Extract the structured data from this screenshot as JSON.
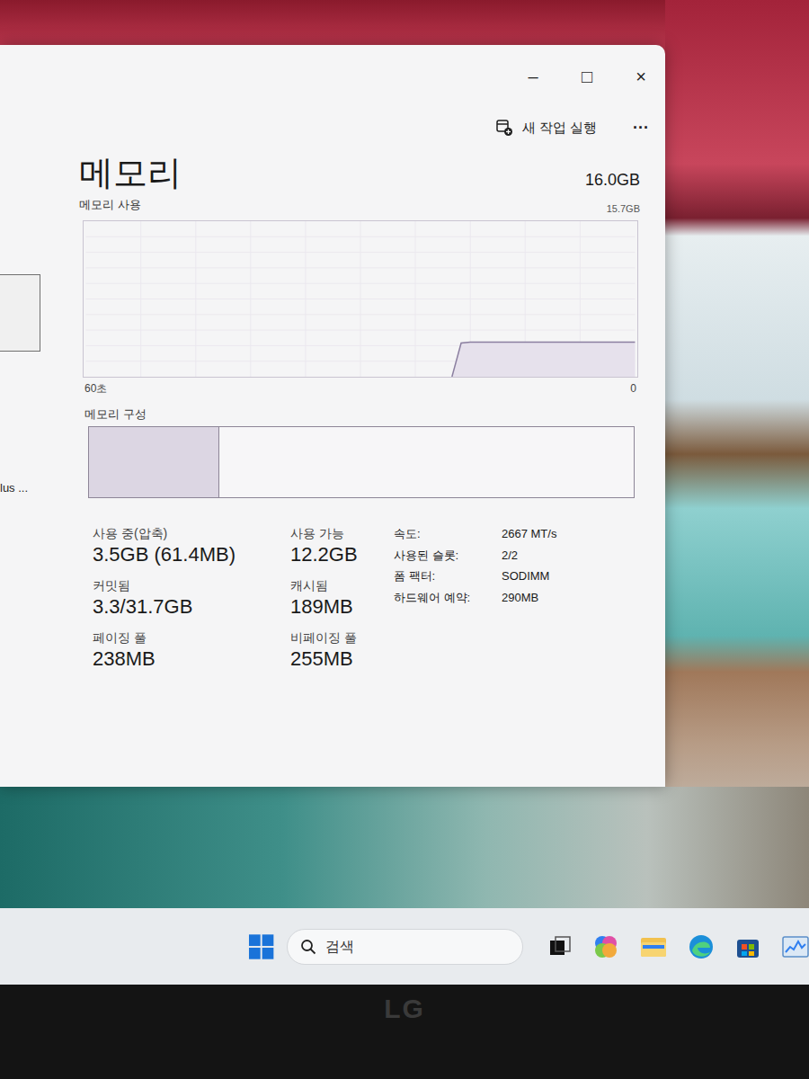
{
  "window": {
    "controls": [
      "–",
      "□",
      "×"
    ]
  },
  "toolbar": {
    "run_task": "새 작업 실행",
    "more": "···"
  },
  "sidebar": {
    "cut_label": "lus ..."
  },
  "header": {
    "title": "메모리",
    "total": "16.0GB",
    "subtitle": "메모리 사용",
    "max": "15.7GB"
  },
  "chart": {
    "axis_max": 15.7,
    "span_seconds": 60,
    "left_label": "60초",
    "right_label": "0",
    "values": [
      0,
      3.4,
      3.5,
      3.5,
      3.5,
      3.5,
      3.5,
      3.5,
      3.5,
      3.5,
      3.5,
      3.5,
      3.5,
      3.5,
      3.5,
      3.5,
      3.5,
      3.5,
      3.5,
      3.5,
      3.5
    ]
  },
  "composition": {
    "label": "메모리 구성",
    "level": 0.24
  },
  "stats": [
    {
      "label": "사용 중(압축)",
      "value": "3.5GB (61.4MB)"
    },
    {
      "label": "사용 가능",
      "value": "12.2GB"
    },
    {
      "label": "커밋됨",
      "value": "3.3/31.7GB"
    },
    {
      "label": "캐시됨",
      "value": "189MB"
    },
    {
      "label": "페이징 풀",
      "value": "238MB"
    },
    {
      "label": "비페이징 풀",
      "value": "255MB"
    }
  ],
  "details": [
    {
      "label": "속도:",
      "value": "2667 MT/s"
    },
    {
      "label": "사용된 슬롯:",
      "value": "2/2"
    },
    {
      "label": "폼 팩터:",
      "value": "SODIMM"
    },
    {
      "label": "하드웨어 예약:",
      "value": "290MB"
    }
  ],
  "taskbar": {
    "search_placeholder": "검색"
  },
  "bezel": {
    "logo": "LG"
  }
}
